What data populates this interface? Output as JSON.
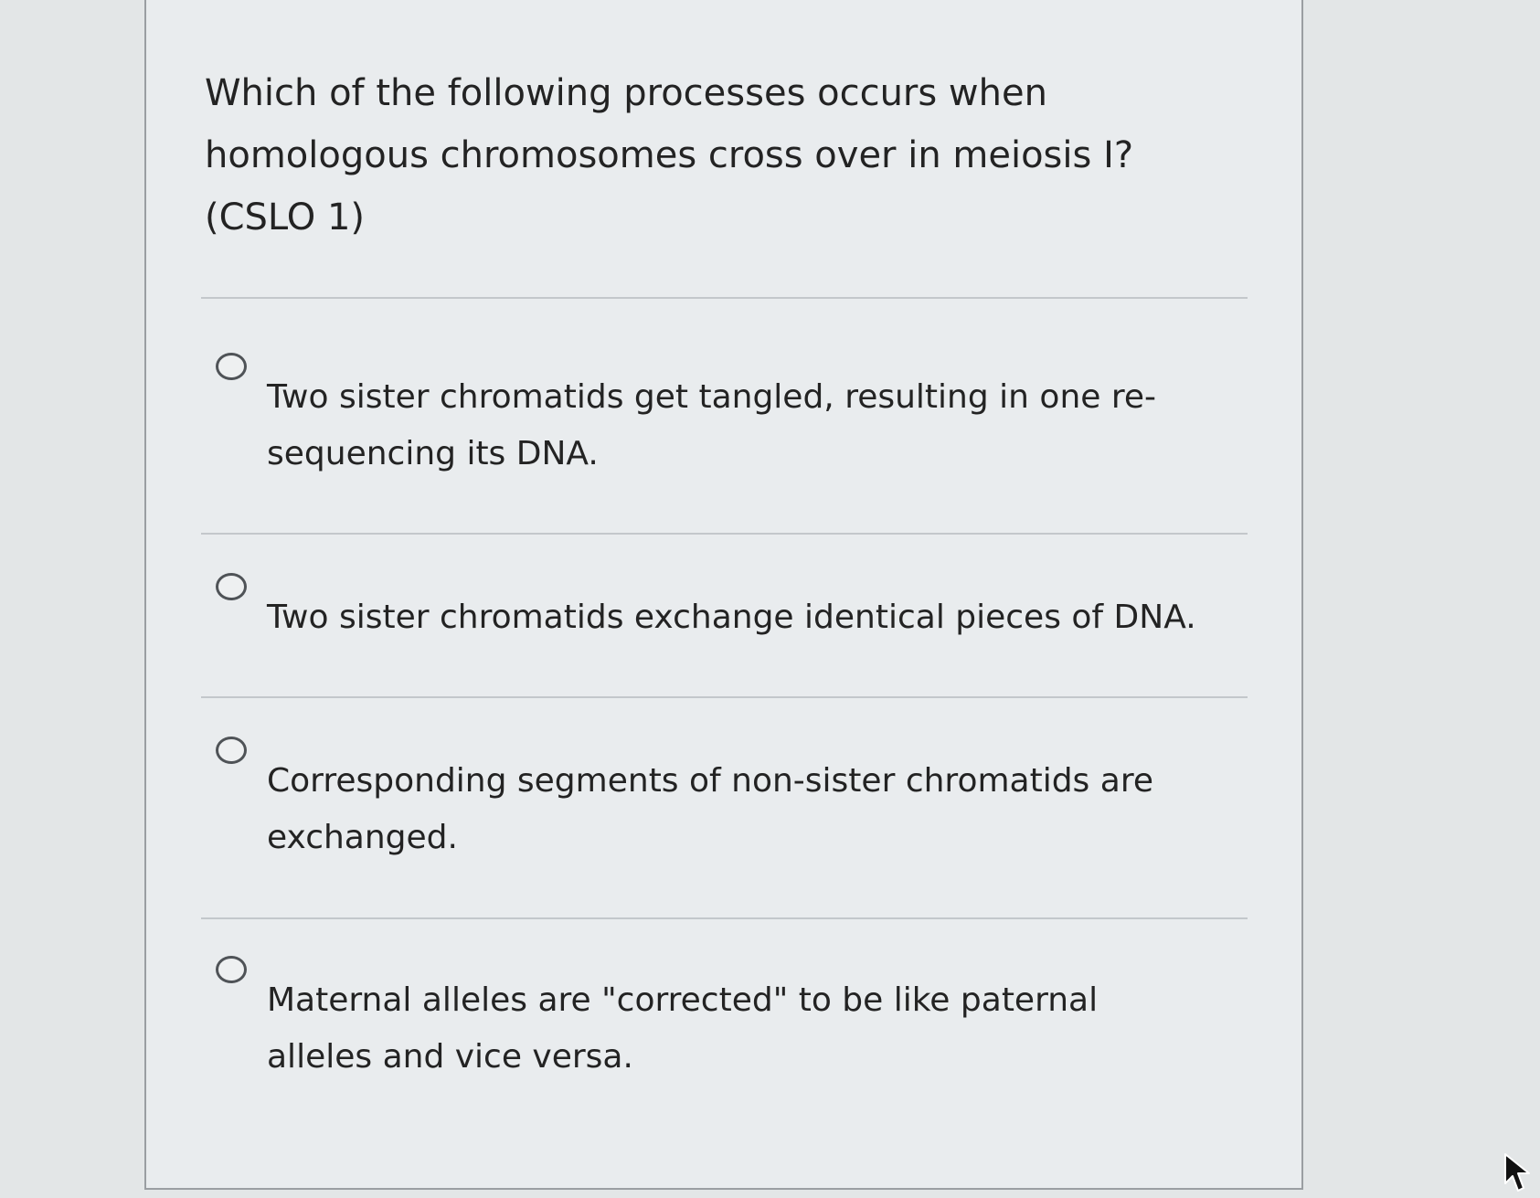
{
  "question": {
    "text": "Which of the following processes occurs when homologous chromosomes cross over in meiosis I? (CSLO 1)"
  },
  "options": [
    {
      "text": "Two sister chromatids get tangled, resulting in one re-sequencing its DNA.",
      "selected": false
    },
    {
      "text": "Two sister chromatids exchange identical pieces of DNA.",
      "selected": false
    },
    {
      "text": "Corresponding segments of non-sister chromatids are exchanged.",
      "selected": false
    },
    {
      "text": "Maternal alleles are \"corrected\" to be like paternal alleles and vice versa.",
      "selected": false
    }
  ],
  "icons": {
    "radio": "radio-button-unselected-icon",
    "cursor": "mouse-pointer-icon"
  },
  "colors": {
    "page_background": "#e3e6e7",
    "card_background": "#e9ecee",
    "text": "#232323",
    "divider": "#c3c7cb"
  }
}
